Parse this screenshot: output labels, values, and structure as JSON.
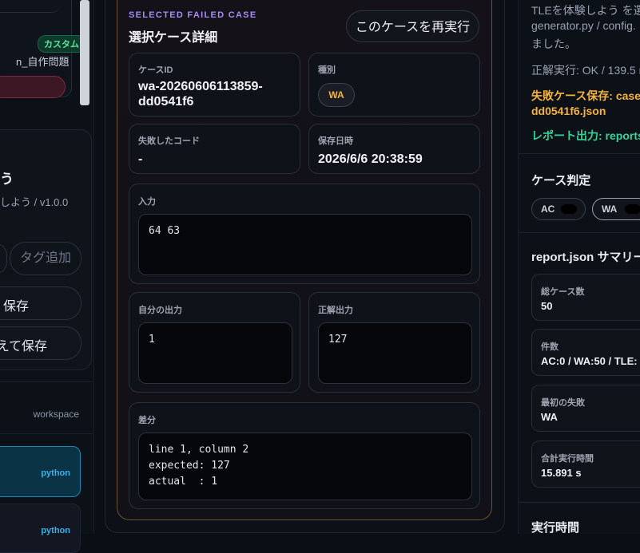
{
  "left": {
    "custom_badge": "カスタム",
    "problem_name": "n_自作問題",
    "section_title": "う",
    "section_subtitle": "しよう / v1.0.0",
    "tag_add": "タグ追加",
    "save_button_1": "保存",
    "save_button_2": "えて保存",
    "workspace_label": "workspace",
    "files": [
      {
        "lang": "python"
      },
      {
        "lang": "python"
      }
    ]
  },
  "detail": {
    "eyebrow": "SELECTED FAILED CASE",
    "title": "選択ケース詳細",
    "rerun_button": "このケースを再実行",
    "case_id_label": "ケースID",
    "case_id_value": "wa-20260606113859-\ndd0541f6",
    "kind_label": "種別",
    "kind_value": "WA",
    "failed_code_label": "失敗したコード",
    "failed_code_value": "-",
    "saved_at_label": "保存日時",
    "saved_at_value": "2026/6/6 20:38:59",
    "input_label": "入力",
    "input_value": "64 63",
    "my_output_label": "自分の出力",
    "my_output_value": "1",
    "expected_output_label": "正解出力",
    "expected_output_value": "127",
    "diff_label": "差分",
    "diff_value": "line 1, column 2\nexpected: 127\nactual  : 1"
  },
  "right": {
    "desc_1": "TLEを体験しよう を選",
    "desc_2": "generator.py / config.",
    "desc_3": "ました。",
    "correct_run": "正解実行: OK / 139.5 m",
    "failed_saved_1": "失敗ケース保存: case",
    "failed_saved_2": "dd0541f6.json",
    "report_output": "レポート出力: reports",
    "verdict_title": "ケース判定",
    "verdicts": [
      "AC",
      "WA"
    ],
    "summary_title": "report.json サマリー",
    "summary": [
      {
        "key": "総ケース数",
        "value": "50"
      },
      {
        "key": "件数",
        "value": "AC:0 / WA:50 / TLE:"
      },
      {
        "key": "最初の失敗",
        "value": "WA"
      },
      {
        "key": "合計実行時間",
        "value": "15.891 s"
      }
    ],
    "runtime_title": "実行時間"
  },
  "colors": {
    "accent_purple": "#a88bf5",
    "warning_orange": "#f5b33a",
    "success_green": "#36d399",
    "python_blue": "#38b0e8"
  }
}
